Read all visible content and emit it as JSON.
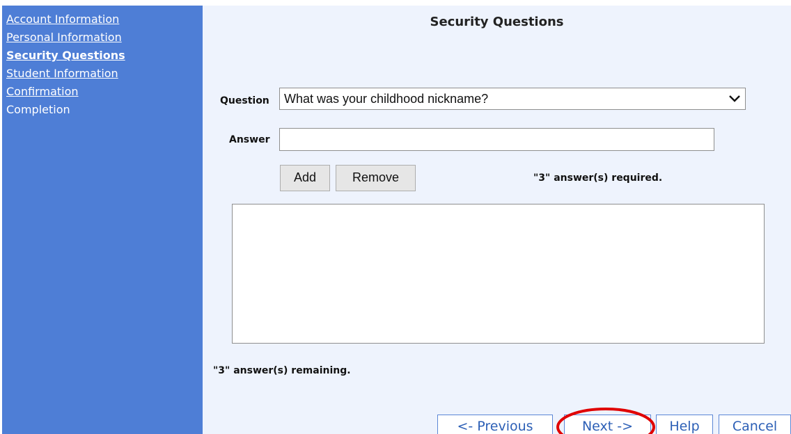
{
  "sidebar": {
    "items": [
      {
        "label": "Account Information"
      },
      {
        "label": "Personal Information"
      },
      {
        "label": "Security Questions"
      },
      {
        "label": "Student Information"
      },
      {
        "label": "Confirmation"
      },
      {
        "label": "Completion"
      }
    ],
    "current": "Security Questions",
    "background_color": "#4e7ed6"
  },
  "main": {
    "title": "Security Questions",
    "question": {
      "label": "Question",
      "selected": "What was your childhood nickname?",
      "icon": "chevron-down-icon"
    },
    "answer": {
      "label": "Answer",
      "value": ""
    },
    "buttons": {
      "add": "Add",
      "remove": "Remove"
    },
    "required_note": "\"3\" answer(s) required.",
    "answers_list": [],
    "remaining_note": "\"3\" answer(s) remaining.",
    "background_color": "#eef3fd"
  },
  "footer": {
    "previous": "<- Previous",
    "next": "Next ->",
    "help": "Help",
    "cancel": "Cancel"
  },
  "annotation": {
    "highlight_color": "#e00000",
    "highlighted": "Next ->"
  }
}
